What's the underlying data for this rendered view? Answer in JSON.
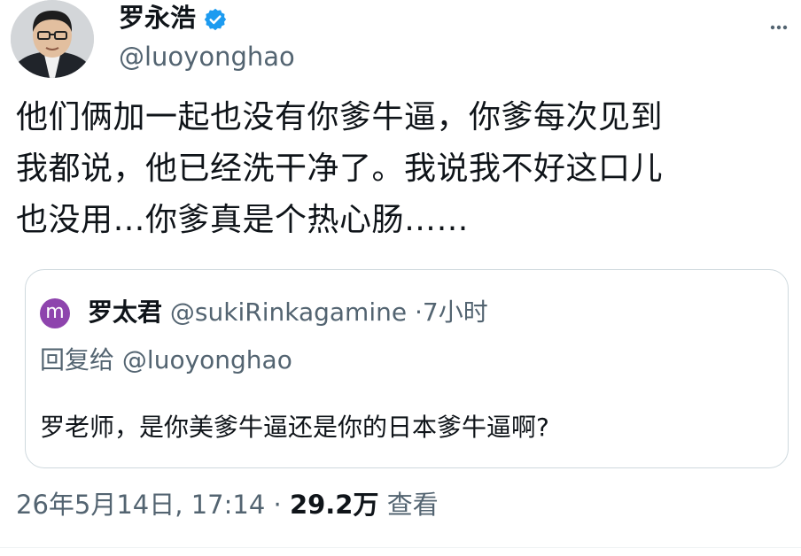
{
  "author": {
    "name": "罗永浩",
    "handle": "@luoyonghao",
    "verified": true,
    "verified_color": "#1d9bf0",
    "avatar_icon": "person-photo"
  },
  "tweet": {
    "text": "他们俩加一起也没有你爹牛逼，你爹每次见到\n我都说，他已经洗干净了。我说我不好这口儿\n也没用…你爹真是个热心肠……"
  },
  "quote": {
    "avatar_letter": "m",
    "avatar_color": "#8e44ad",
    "name": "罗太君",
    "handle": "@sukiRinkagamine",
    "separator": "·",
    "time": "7小时",
    "reply_prefix": "回复给",
    "reply_to": "@luoyonghao",
    "text": "罗老师，是你美爹牛逼还是你的日本爹牛逼啊?"
  },
  "meta": {
    "date": "26年5月14日",
    "time": "17:14",
    "separator": "·",
    "views_count": "29.2万",
    "views_label": "查看"
  },
  "colors": {
    "text": "#0f1419",
    "secondary": "#536471",
    "border": "#cfd9de"
  }
}
